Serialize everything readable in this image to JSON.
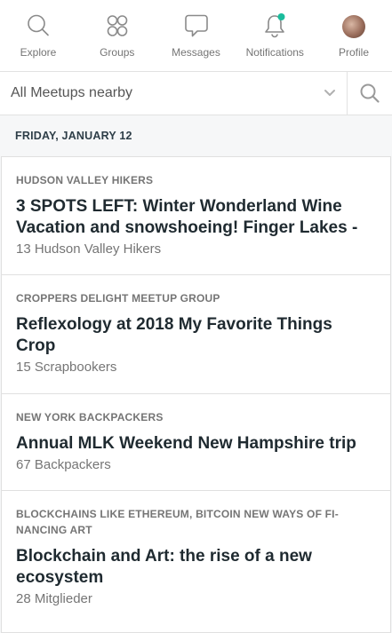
{
  "nav": {
    "items": [
      {
        "label": "Explore",
        "icon": "search-icon"
      },
      {
        "label": "Groups",
        "icon": "groups-icon"
      },
      {
        "label": "Messages",
        "icon": "message-bubble-icon"
      },
      {
        "label": "Notifications",
        "icon": "bell-icon"
      },
      {
        "label": "Profile",
        "icon": "avatar"
      }
    ],
    "notification_dot_color": "#1abc9c"
  },
  "filter": {
    "selected": "All Meetups nearby"
  },
  "day_header": "FRIDAY, JANUARY 12",
  "events": [
    {
      "group": "HUDSON VALLEY HIKERS",
      "title": "3 SPOTS LEFT: Winter Wonderland Wine Vacation and snowshoeing! Finger Lakes -",
      "attendees": "13 Hudson Valley Hikers"
    },
    {
      "group": "CROPPERS DELIGHT MEETUP GROUP",
      "title": "Reflexology at 2018 My Favorite Things Crop",
      "attendees": "15 Scrapbookers"
    },
    {
      "group": "NEW YORK BACKPACKERS",
      "title": "Annual MLK Weekend New Hampshire trip",
      "attendees": "67 Backpackers"
    },
    {
      "group": "BLOCKCHAINS LIKE ETHEREUM, BITCOIN NEW WAYS OF FI-NANCING ART",
      "title": "Blockchain and Art: the rise of a new ecosystem",
      "attendees": "28 Mitglieder"
    }
  ]
}
